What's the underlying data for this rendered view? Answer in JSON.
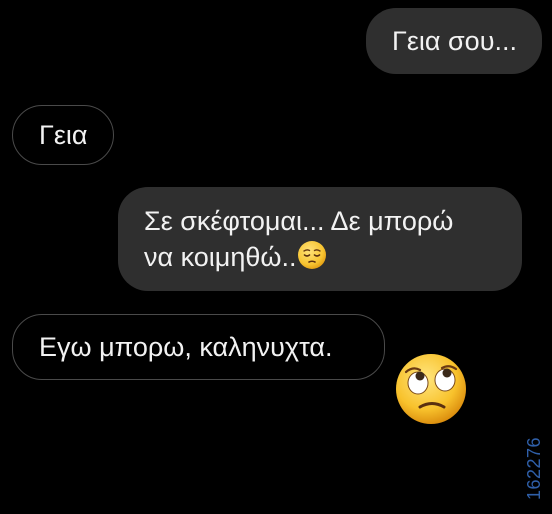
{
  "conversation": {
    "messages": [
      {
        "direction": "sent",
        "text": "Γεια σου..."
      },
      {
        "direction": "received",
        "text": "Γεια"
      },
      {
        "direction": "sent",
        "lines": [
          "Σε σκέφτομαι... Δε μπορώ",
          "να κοιμηθώ.."
        ],
        "emoji": "pensive-face-emoji"
      },
      {
        "direction": "received",
        "text": "Εγω μπορω, καληνυχτα."
      }
    ],
    "reaction": {
      "emoji": "face-with-rolling-eyes-emoji"
    }
  },
  "watermark": {
    "text": "162276"
  },
  "colors": {
    "background": "#000000",
    "sent_bubble": "#2f2f2f",
    "received_border": "#4a4a4a",
    "text": "#f2f2f2",
    "watermark": "#2f5fa8"
  }
}
